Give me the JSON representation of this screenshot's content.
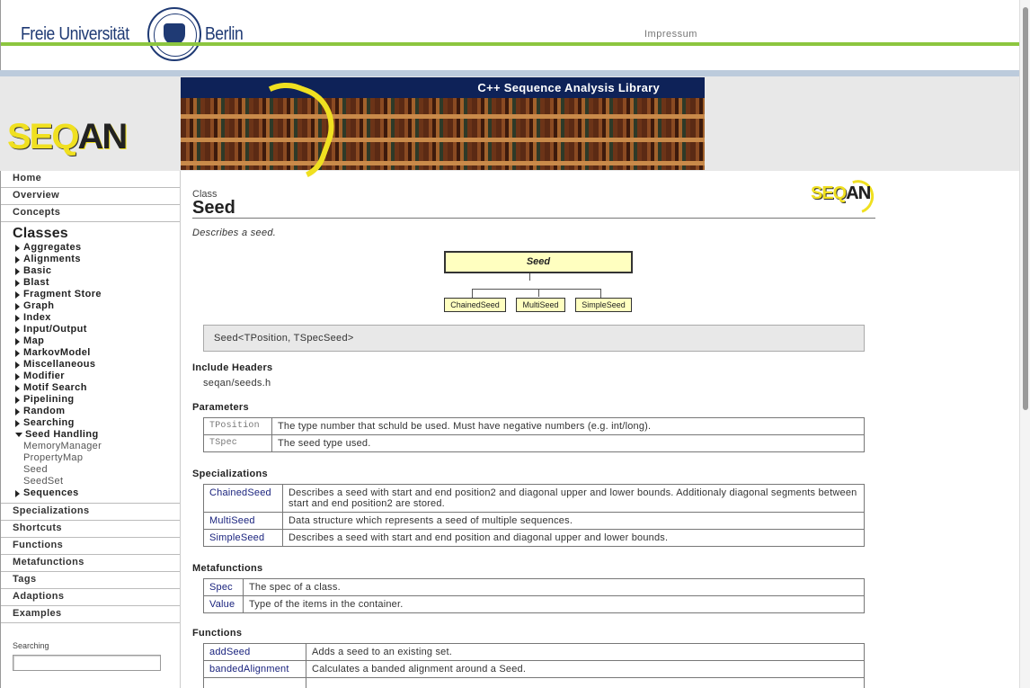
{
  "header": {
    "uni_left": "Freie Universität",
    "uni_right": "Berlin",
    "impressum": "Impressum"
  },
  "banner": {
    "title": "C++ Sequence Analysis Library",
    "logo_a": "SEQ",
    "logo_b": "AN"
  },
  "sidebar": {
    "top_items": [
      "Home",
      "Overview",
      "Concepts"
    ],
    "classes_heading": "Classes",
    "classes": [
      "Aggregates",
      "Alignments",
      "Basic",
      "Blast",
      "Fragment Store",
      "Graph",
      "Index",
      "Input/Output",
      "Map",
      "MarkovModel",
      "Miscellaneous",
      "Modifier",
      "Motif Search",
      "Pipelining",
      "Random",
      "Searching"
    ],
    "expanded_class": "Seed Handling",
    "expanded_children": [
      "MemoryManager",
      "PropertyMap",
      "Seed",
      "SeedSet"
    ],
    "after_expanded": "Sequences",
    "bottom_items": [
      "Specializations",
      "Shortcuts",
      "Functions",
      "Metafunctions",
      "Tags",
      "Adaptions",
      "Examples"
    ],
    "search_label": "Searching",
    "search_value": ""
  },
  "main": {
    "kind": "Class",
    "title": "Seed",
    "description": "Describes a seed.",
    "diagram": {
      "root": "Seed",
      "children": [
        "ChainedSeed",
        "MultiSeed",
        "SimpleSeed"
      ]
    },
    "signature": "Seed<TPosition, TSpecSeed>",
    "include_heading": "Include Headers",
    "include": "seqan/seeds.h",
    "parameters_heading": "Parameters",
    "parameters": [
      {
        "name": "TPosition",
        "desc": "The type number that schuld be used. Must have negative numbers (e.g. int/long)."
      },
      {
        "name": "TSpec",
        "desc": "The seed type used."
      }
    ],
    "specializations_heading": "Specializations",
    "specializations": [
      {
        "name": "ChainedSeed",
        "desc": "Describes a seed with start and end position2 and diagonal upper and lower bounds. Additionaly diagonal segments between start and end position2 are stored."
      },
      {
        "name": "MultiSeed",
        "desc": "Data structure which represents a seed of multiple sequences."
      },
      {
        "name": "SimpleSeed",
        "desc": "Describes a seed with start and end position and diagonal upper and lower bounds."
      }
    ],
    "metafunctions_heading": "Metafunctions",
    "metafunctions": [
      {
        "name": "Spec",
        "desc": "The spec of a class."
      },
      {
        "name": "Value",
        "desc": "Type of the items in the container."
      }
    ],
    "functions_heading": "Functions",
    "functions": [
      {
        "name": "addSeed",
        "desc": "Adds a seed to an existing set."
      },
      {
        "name": "bandedAlignment",
        "desc": "Calculates a banded alignment around a Seed."
      }
    ]
  }
}
